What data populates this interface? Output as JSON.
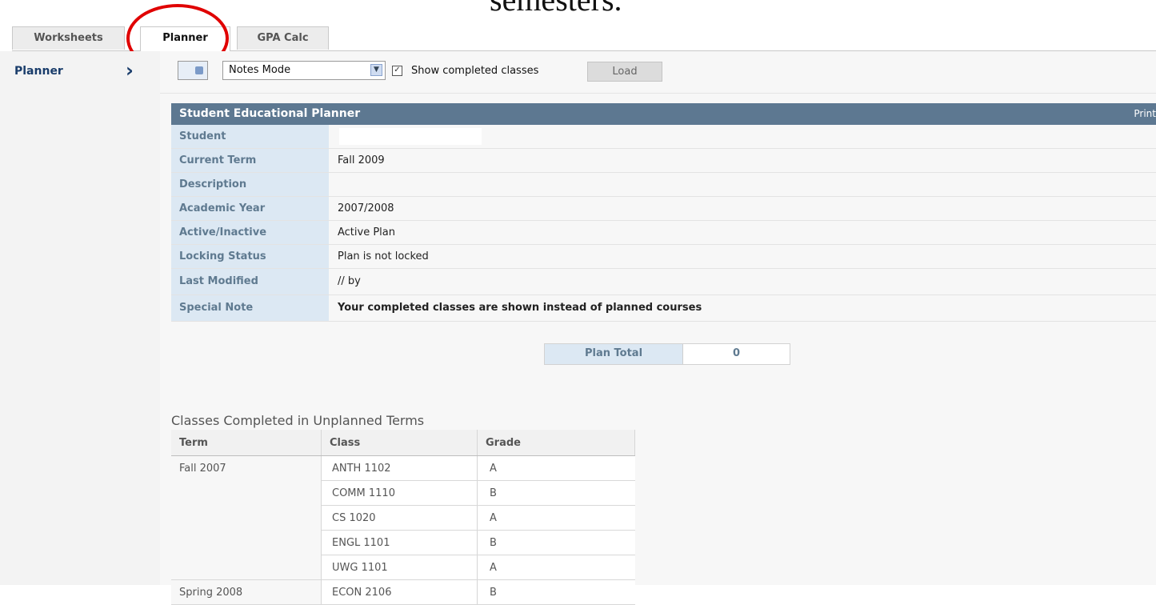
{
  "caption": "semesters.",
  "tabs": {
    "worksheets": "Worksheets",
    "planner": "Planner",
    "gpa_calc": "GPA Calc"
  },
  "nav": {
    "planner_label": "Planner",
    "chevron": "›"
  },
  "toolbar": {
    "mode_value": "Notes Mode",
    "show_completed_label": "Show completed classes",
    "show_completed_checked": true,
    "load_label": "Load"
  },
  "plan": {
    "header": "Student Educational Planner",
    "print_label": "Print",
    "rows": [
      {
        "label": "Student",
        "value": ""
      },
      {
        "label": "Current Term",
        "value": "Fall 2009"
      },
      {
        "label": "Description",
        "value": ""
      },
      {
        "label": "Academic Year",
        "value": "2007/2008"
      },
      {
        "label": "Active/Inactive",
        "value": "Active Plan"
      },
      {
        "label": "Locking Status",
        "value": "Plan is not locked"
      },
      {
        "label": "Last Modified",
        "value": "// by"
      },
      {
        "label": "Special Note",
        "value": "Your completed classes are shown instead of planned courses"
      }
    ],
    "plan_total_label": "Plan Total",
    "plan_total_value": "0"
  },
  "classes": {
    "title": "Classes Completed in Unplanned Terms",
    "columns": [
      "Term",
      "Class",
      "Grade"
    ],
    "rows": [
      {
        "term": "Fall 2007",
        "class": "ANTH 1102",
        "grade": "A"
      },
      {
        "term": "",
        "class": "COMM 1110",
        "grade": "B"
      },
      {
        "term": "",
        "class": "CS 1020",
        "grade": "A"
      },
      {
        "term": "",
        "class": "ENGL 1101",
        "grade": "B"
      },
      {
        "term": "",
        "class": "UWG 1101",
        "grade": "A"
      },
      {
        "term": "Spring 2008",
        "class": "ECON 2106",
        "grade": "B"
      }
    ]
  },
  "colors": {
    "header_bg": "#5d7891",
    "label_bg": "#dce8f3",
    "label_text": "#5f7a90",
    "annotation": "#e00000"
  }
}
